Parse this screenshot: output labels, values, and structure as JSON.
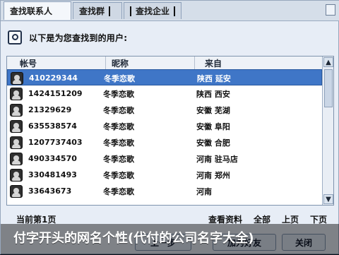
{
  "tabs": [
    {
      "label": "查找联系人",
      "active": true
    },
    {
      "label": "查找群",
      "active": false
    },
    {
      "label": "查找企业",
      "active": false
    }
  ],
  "info": {
    "text": "以下是为您查找到的用户:"
  },
  "table": {
    "headers": [
      "帐号",
      "昵称",
      "来自"
    ],
    "rows": [
      {
        "account": "410229344",
        "nickname": "冬季恋歌",
        "from": "陕西 延安",
        "selected": true
      },
      {
        "account": "1424151209",
        "nickname": "冬季恋歌",
        "from": "陕西 西安",
        "selected": false
      },
      {
        "account": "21329629",
        "nickname": "冬季恋歌",
        "from": "安徽 芜湖",
        "selected": false
      },
      {
        "account": "635538574",
        "nickname": "冬季恋歌",
        "from": "安徽 阜阳",
        "selected": false
      },
      {
        "account": "1207737403",
        "nickname": "冬季恋歌",
        "from": "安徽 合肥",
        "selected": false
      },
      {
        "account": "490334570",
        "nickname": "冬季恋歌",
        "from": "河南 驻马店",
        "selected": false
      },
      {
        "account": "330481493",
        "nickname": "冬季恋歌",
        "from": "河南 郑州",
        "selected": false
      },
      {
        "account": "33643673",
        "nickname": "冬季恋歌",
        "from": "河南",
        "selected": false
      }
    ]
  },
  "footer": {
    "page": "当前第1页",
    "actions": [
      "查看资料",
      "全部",
      "上页",
      "下页"
    ]
  },
  "buttons": {
    "prev": "上一步",
    "add": "加为好友",
    "close": "关闭"
  },
  "caption": {
    "text": "付字开头的网名个性(代付的公司名字大全)"
  }
}
